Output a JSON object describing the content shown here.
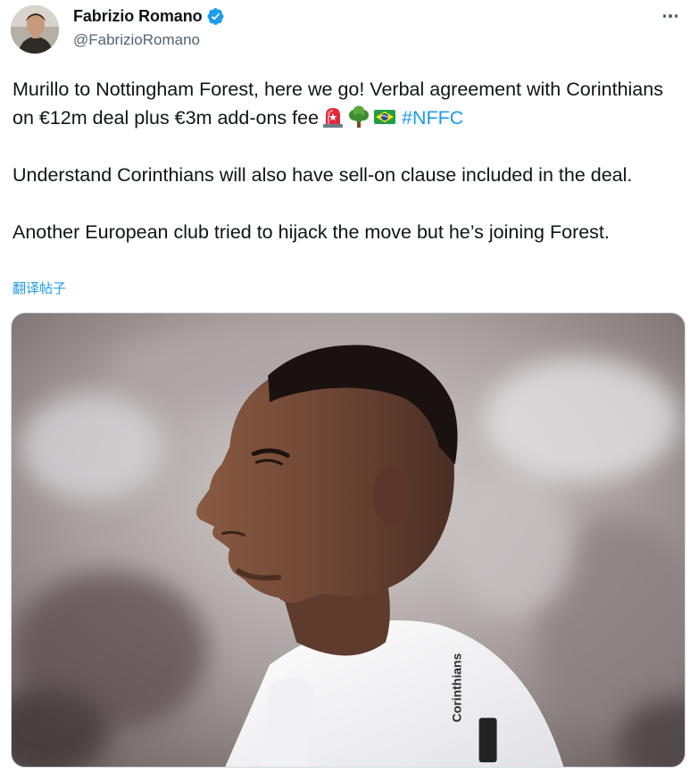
{
  "author": {
    "display_name": "Fabrizio Romano",
    "handle": "@FabrizioRomano",
    "verified": true,
    "verified_color": "#1d9bf0"
  },
  "tweet": {
    "line1": "Murillo to Nottingham Forest, here we go! Verbal agreement with Corinthians on €12m deal plus €3m add-ons fee",
    "emojis": [
      "rotating-light-emoji",
      "tree-emoji",
      "brazil-flag-emoji"
    ],
    "hashtag": "#NFFC",
    "line2": "Understand Corinthians will also have sell-on clause included in the deal.",
    "line3": "Another European club tried to hijack the move but he’s joining Forest.",
    "translate_label": "翻译帖子"
  },
  "media": {
    "description_icon": "player-photo",
    "shirt_text": "Corinthians"
  },
  "colors": {
    "text": "#0f1419",
    "secondary": "#536471",
    "link": "#1d9bf0"
  }
}
